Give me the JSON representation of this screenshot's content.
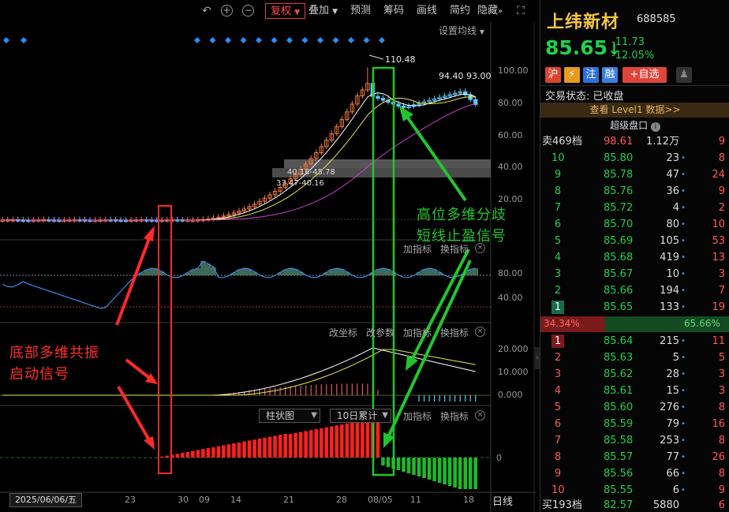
{
  "toolbar": {
    "undo_icon": "undo-icon",
    "zoom_in_icon": "zoom-in-icon",
    "zoom_out_icon": "zoom-out-icon",
    "fuquan_label": "复权",
    "diejia_label": "叠加",
    "yuce_label": "预测",
    "chouma_label": "筹码",
    "huaxian_label": "画线",
    "jianyue_label": "简约",
    "yincang_label": "隐藏",
    "expand_icon": "expand-icon"
  },
  "main_chart": {
    "ma_setting_label": "设置均线",
    "high_label": "110.48",
    "last_label": "93.00",
    "last_label_prefix": "94.40",
    "y_ticks": [
      "100.00",
      "80.00",
      "60.00",
      "40.00",
      "20.00"
    ],
    "chip_labels": [
      "40.16-45.78",
      "33.47-40.16"
    ]
  },
  "pane2": {
    "add_label": "加指标",
    "switch_label": "换指标",
    "y_ticks": [
      "80.00",
      "40.00"
    ]
  },
  "pane3": {
    "coord_label": "改坐标",
    "param_label": "改参数",
    "add_label": "加指标",
    "switch_label": "换指标",
    "y_ticks": [
      "20.000",
      "10.000",
      "0.000"
    ]
  },
  "pane4": {
    "style_dropdown": "柱状图",
    "period_dropdown": "10日累计",
    "add_label": "加指标",
    "switch_label": "换指标",
    "y_tick": "0"
  },
  "x_axis": {
    "date_box": "2025/06/06/五",
    "ticks": [
      "23",
      "30",
      "09",
      "14",
      "21",
      "28",
      "08/05",
      "11",
      "18"
    ],
    "period_label": "日线"
  },
  "annotations": {
    "left_line1": "底部多维共振",
    "left_line2": "启动信号",
    "right_line1": "高位多维分歧",
    "right_line2": "短线止盈信号"
  },
  "stock": {
    "name": "上纬新材",
    "code": "688585",
    "price": "85.65",
    "arrow": "↓",
    "change": "-11.73",
    "change_pct": "-12.05%",
    "tags": [
      "沪",
      "⚡",
      "注",
      "融"
    ],
    "add_watch": "+自选",
    "status_label": "交易状态:",
    "status_value": "已收盘",
    "level1_link": "查看 Level1 数据>>",
    "super_order_label": "超级盘口",
    "sell_summary": {
      "label": "卖469档",
      "price": "98.61",
      "vol": "1.12万",
      "count": "9"
    },
    "buy_summary": {
      "label": "买193档",
      "price": "82.57",
      "vol": "5880",
      "count": "6"
    },
    "ratio_left": "34.34%",
    "ratio_right": "65.66%"
  },
  "asks": [
    {
      "level": "10",
      "price": "85.80",
      "vol": "23",
      "count": "8"
    },
    {
      "level": "9",
      "price": "85.78",
      "vol": "47",
      "count": "24"
    },
    {
      "level": "8",
      "price": "85.76",
      "vol": "36",
      "count": "9"
    },
    {
      "level": "7",
      "price": "85.72",
      "vol": "4",
      "count": "2"
    },
    {
      "level": "6",
      "price": "85.70",
      "vol": "80",
      "count": "10"
    },
    {
      "level": "5",
      "price": "85.69",
      "vol": "105",
      "count": "53"
    },
    {
      "level": "4",
      "price": "85.68",
      "vol": "419",
      "count": "13"
    },
    {
      "level": "3",
      "price": "85.67",
      "vol": "10",
      "count": "3"
    },
    {
      "level": "2",
      "price": "85.66",
      "vol": "194",
      "count": "7"
    },
    {
      "level": "1",
      "price": "85.65",
      "vol": "133",
      "count": "19"
    }
  ],
  "bids": [
    {
      "level": "1",
      "price": "85.64",
      "vol": "215",
      "count": "11"
    },
    {
      "level": "2",
      "price": "85.63",
      "vol": "5",
      "count": "5"
    },
    {
      "level": "3",
      "price": "85.62",
      "vol": "28",
      "count": "3"
    },
    {
      "level": "4",
      "price": "85.61",
      "vol": "15",
      "count": "3"
    },
    {
      "level": "5",
      "price": "85.60",
      "vol": "276",
      "count": "8"
    },
    {
      "level": "6",
      "price": "85.59",
      "vol": "79",
      "count": "16"
    },
    {
      "level": "7",
      "price": "85.58",
      "vol": "253",
      "count": "8"
    },
    {
      "level": "8",
      "price": "85.57",
      "vol": "77",
      "count": "26"
    },
    {
      "level": "9",
      "price": "85.56",
      "vol": "66",
      "count": "8"
    },
    {
      "level": "10",
      "price": "85.55",
      "vol": "6",
      "count": "9"
    }
  ],
  "colors": {
    "up": "#ff3b3b",
    "down": "#1fd14a",
    "annot_red": "#ff3030",
    "annot_green": "#22c52e",
    "name_yellow": "#f5c542"
  }
}
